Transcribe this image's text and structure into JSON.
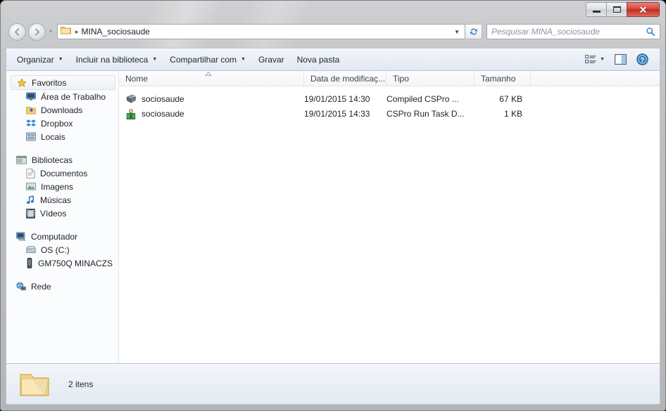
{
  "window": {
    "controls": {
      "minimize": "Minimizar",
      "maximize": "Maximizar",
      "close": "Fechar",
      "close_glyph": "✕"
    }
  },
  "nav": {
    "back_label": "Voltar",
    "forward_label": "Avançar",
    "history_label": "Páginas recentes",
    "breadcrumb_separator": "▸",
    "path": "MINA_sociosaude",
    "address_dropdown": "▼",
    "refresh_label": "Atualizar"
  },
  "search": {
    "placeholder": "Pesquisar MINA_sociosaude",
    "value": "",
    "icon": "search-icon"
  },
  "toolbar": {
    "items": [
      {
        "label": "Organizar",
        "caret": "▼"
      },
      {
        "label": "Incluir na biblioteca",
        "caret": "▼"
      },
      {
        "label": "Compartilhar com",
        "caret": "▼"
      },
      {
        "label": "Gravar",
        "caret": ""
      },
      {
        "label": "Nova pasta",
        "caret": ""
      }
    ],
    "view_caret": "▼",
    "view_label": "Alterar modo de exibição",
    "preview_label": "Mostrar painel de visualização",
    "help_label": "Ajuda",
    "help_glyph": "?"
  },
  "sidebar": {
    "groups": [
      {
        "head": {
          "label": "Favoritos",
          "icon": "star-icon",
          "selected": true
        },
        "items": [
          {
            "label": "Área de Trabalho",
            "icon": "desktop-icon"
          },
          {
            "label": "Downloads",
            "icon": "downloads-icon"
          },
          {
            "label": "Dropbox",
            "icon": "dropbox-icon"
          },
          {
            "label": "Locais",
            "icon": "recent-places-icon"
          }
        ]
      },
      {
        "head": {
          "label": "Bibliotecas",
          "icon": "libraries-icon",
          "selected": false
        },
        "items": [
          {
            "label": "Documentos",
            "icon": "documents-icon"
          },
          {
            "label": "Imagens",
            "icon": "pictures-icon"
          },
          {
            "label": "Músicas",
            "icon": "music-icon"
          },
          {
            "label": "Vídeos",
            "icon": "videos-icon"
          }
        ]
      },
      {
        "head": {
          "label": "Computador",
          "icon": "computer-icon",
          "selected": false
        },
        "items": [
          {
            "label": "OS (C:)",
            "icon": "harddisk-icon"
          },
          {
            "label": "GM750Q MINACZS",
            "icon": "phone-icon"
          }
        ]
      },
      {
        "head": {
          "label": "Rede",
          "icon": "network-icon",
          "selected": false
        },
        "items": []
      }
    ]
  },
  "filelist": {
    "columns": [
      {
        "key": "name",
        "label": "Nome",
        "align": "left"
      },
      {
        "key": "date",
        "label": "Data de modificaç...",
        "align": "left"
      },
      {
        "key": "type",
        "label": "Tipo",
        "align": "left"
      },
      {
        "key": "size",
        "label": "Tamanho",
        "align": "right"
      }
    ],
    "sort_column": "Nome",
    "sort_direction": "asc",
    "rows": [
      {
        "name": "sociosaude",
        "date": "19/01/2015 14:30",
        "type": "Compiled CSPro ...",
        "size": "67 KB",
        "icon": "cspro-compiled-icon"
      },
      {
        "name": "sociosaude",
        "date": "19/01/2015 14:33",
        "type": "CSPro Run Task D...",
        "size": "1 KB",
        "icon": "cspro-runtask-icon"
      }
    ]
  },
  "statusbar": {
    "icon": "folder-icon",
    "text": "2 itens"
  },
  "colors": {
    "accent": "#2f6fab",
    "window_frame": "#c6c7c9",
    "close_button": "#c0392b",
    "pane_background": "#ffffff",
    "sidebar_background": "#fbfcfd",
    "toolbar_background": "#eaeff6",
    "folder_yellow": "#f6d67a"
  }
}
